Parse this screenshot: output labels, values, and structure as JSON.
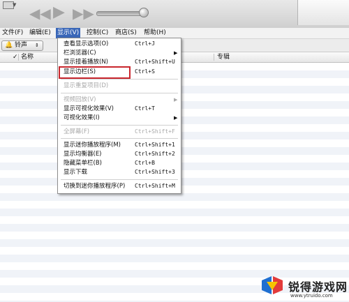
{
  "menubar": {
    "file": "文件(F)",
    "edit": "编辑(E)",
    "view": "显示(V)",
    "controls": "控制(C)",
    "store": "商店(S)",
    "help": "帮助(H)"
  },
  "source_selector": {
    "label": "铃声",
    "icon": "bell-icon"
  },
  "columns": {
    "name": "名称",
    "album": "专辑"
  },
  "view_menu": {
    "items": [
      {
        "label": "查看显示选项(O)",
        "shortcut": "Ctrl+J"
      },
      {
        "label": "栏浏览器(C)",
        "shortcut": ""
      },
      {
        "label": "显示接着播放(N)",
        "shortcut": "Ctrl+Shift+U"
      },
      {
        "label": "显示边栏(S)",
        "shortcut": "Ctrl+S"
      },
      {
        "label": "显示重复项目(D)",
        "shortcut": ""
      },
      {
        "label": "视频回放(V)",
        "shortcut": ""
      },
      {
        "label": "显示可视化效果(V)",
        "shortcut": "Ctrl+T"
      },
      {
        "label": "可视化效果(I)",
        "shortcut": ""
      },
      {
        "label": "全屏幕(F)",
        "shortcut": "Ctrl+Shift+F"
      },
      {
        "label": "显示迷你播放程序(M)",
        "shortcut": "Ctrl+Shift+1"
      },
      {
        "label": "显示均衡器(E)",
        "shortcut": "Ctrl+Shift+2"
      },
      {
        "label": "隐藏菜单栏(B)",
        "shortcut": "Ctrl+B"
      },
      {
        "label": "显示下载",
        "shortcut": "Ctrl+Shift+3"
      },
      {
        "label": "切换到迷你播放程序(P)",
        "shortcut": "Ctrl+Shift+M"
      }
    ]
  },
  "watermark": {
    "brand": "锐得游戏网",
    "url": "www.ytruido.com"
  },
  "colors": {
    "menu_highlight": "#3a67b8",
    "annotation_box": "#c9262d"
  }
}
